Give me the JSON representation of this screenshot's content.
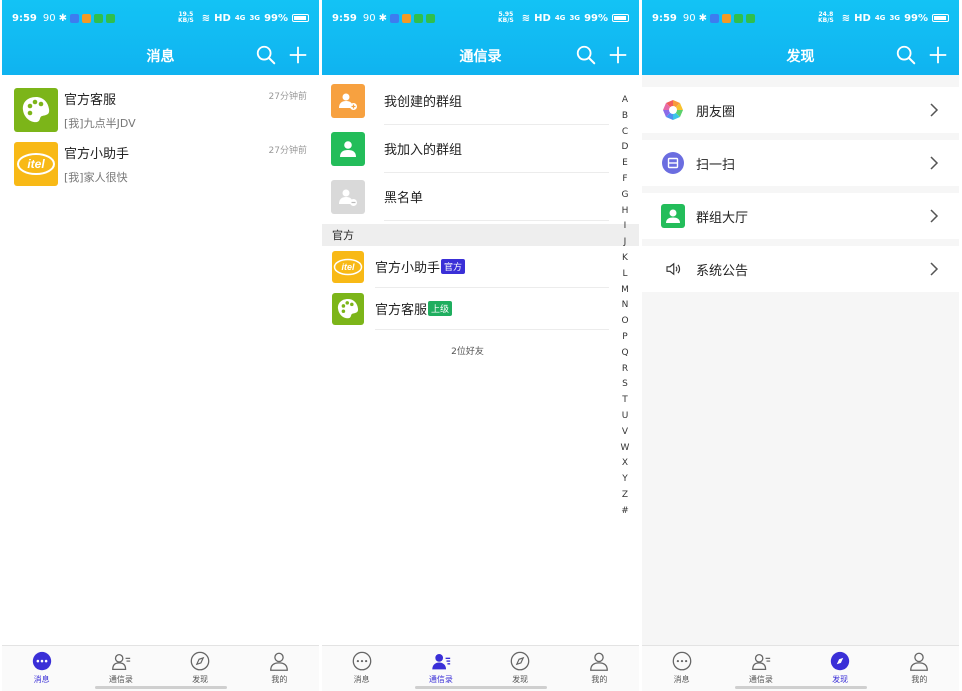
{
  "status_bar": {
    "time": "9:59",
    "signal_text": "HD",
    "battery": "99%",
    "speeds": [
      "19.5",
      "5.95",
      "24.8"
    ],
    "speed_unit": "KB/S",
    "net_4g": "4G",
    "net_3g": "3G",
    "nfc": "90"
  },
  "colors": {
    "header": "#10b3f0",
    "active_tab": "#3a2fd7"
  },
  "messages_screen": {
    "title": "消息",
    "items": [
      {
        "name": "官方客服",
        "preview": "[我]九点半JDV",
        "time": "27分钟前",
        "avatar_icon": "palette-icon"
      },
      {
        "name": "官方小助手",
        "preview": "[我]家人很快",
        "time": "27分钟前",
        "avatar_icon": "itel-logo"
      }
    ]
  },
  "contacts_screen": {
    "title": "通信录",
    "groups": [
      {
        "label": "我创建的群组",
        "icon": "create-group-icon"
      },
      {
        "label": "我加入的群组",
        "icon": "joined-group-icon"
      },
      {
        "label": "黑名单",
        "icon": "blacklist-icon"
      }
    ],
    "section": "官方",
    "friends": [
      {
        "name": "官方小助手",
        "badge": "官方"
      },
      {
        "name": "官方客服",
        "badge": "上级"
      }
    ],
    "friend_count": "2位好友",
    "alphabet": [
      "A",
      "B",
      "C",
      "D",
      "E",
      "F",
      "G",
      "H",
      "I",
      "J",
      "K",
      "L",
      "M",
      "N",
      "O",
      "P",
      "Q",
      "R",
      "S",
      "T",
      "U",
      "V",
      "W",
      "X",
      "Y",
      "Z",
      "#"
    ]
  },
  "discover_screen": {
    "title": "发现",
    "items": [
      {
        "label": "朋友圈",
        "icon": "moments-icon"
      },
      {
        "label": "扫一扫",
        "icon": "scan-icon"
      },
      {
        "label": "群组大厅",
        "icon": "group-hall-icon"
      },
      {
        "label": "系统公告",
        "icon": "speaker-icon"
      }
    ]
  },
  "tabbar": {
    "tabs": [
      {
        "label": "消息",
        "icon": "chat-bubble-icon"
      },
      {
        "label": "通信录",
        "icon": "contacts-icon"
      },
      {
        "label": "发现",
        "icon": "compass-icon"
      },
      {
        "label": "我的",
        "icon": "person-icon"
      }
    ]
  }
}
